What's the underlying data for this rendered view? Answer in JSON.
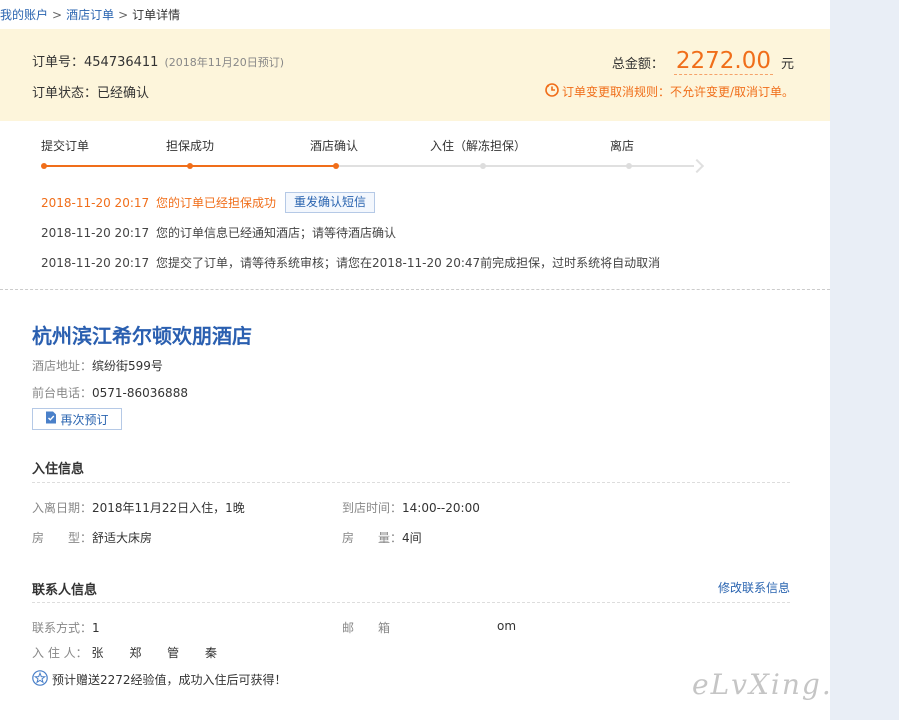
{
  "breadcrumb": {
    "account": "我的账户",
    "sep1": ">",
    "hotel_orders": "酒店订单",
    "sep2": ">",
    "current": "订单详情"
  },
  "order": {
    "number_label": "订单号：",
    "number": "454736411",
    "booked_note": "(2018年11月20日预订)",
    "status_label": "订单状态：",
    "status": "已经确认",
    "total_label": "总金额：",
    "total": "2272.00",
    "currency": "元",
    "cancel_rule": "订单变更取消规则：不允许变更/取消订单。"
  },
  "steps": [
    {
      "label": "提交订单",
      "done": true
    },
    {
      "label": "担保成功",
      "done": true
    },
    {
      "label": "酒店确认",
      "done": true
    },
    {
      "label": "入住（解冻担保）",
      "done": false
    },
    {
      "label": "离店",
      "done": false
    }
  ],
  "logs": [
    {
      "time": "2018-11-20 20:17",
      "text": "您的订单已经担保成功",
      "highlight": true
    },
    {
      "time": "2018-11-20 20:17",
      "text": "您的订单信息已经通知酒店；请等待酒店确认",
      "highlight": false
    },
    {
      "time": "2018-11-20 20:17",
      "text": "您提交了订单，请等待系统审核；请您在2018-11-20 20:47前完成担保，过时系统将自动取消",
      "highlight": false
    }
  ],
  "resend_sms_label": "重发确认短信",
  "hotel": {
    "name": "杭州滨江希尔顿欢朋酒店",
    "address_label": "酒店地址：",
    "address": "缤纷街599号",
    "phone_label": "前台电话：",
    "phone": "0571-86036888",
    "rebook_label": "再次预订"
  },
  "checkin": {
    "title": "入住信息",
    "dates_label": "入离日期：",
    "dates": "2018年11月22日入住，1晚",
    "arrival_label": "到店时间：",
    "arrival": "14:00--20:00",
    "room_type_label": "房　　型：",
    "room_type": "舒适大床房",
    "room_count_label": "房　　量：",
    "room_count": "4间"
  },
  "contact": {
    "title": "联系人信息",
    "edit_label": "修改联系信息",
    "method_label": "联系方式：",
    "method": "1",
    "email_label": "邮　　箱",
    "email_tail": "om",
    "guests_label": "入 住 人：",
    "guests": [
      "张",
      "郑",
      "管",
      "秦"
    ]
  },
  "bonus_text": "预计赠送2272经验值，成功入住后可获得！",
  "watermark": "eLvXing.net",
  "colors": {
    "accent": "#f06e1a",
    "link": "#2a64b0",
    "banner_bg": "#fdf5db",
    "panel_bg": "#e9eef6"
  }
}
